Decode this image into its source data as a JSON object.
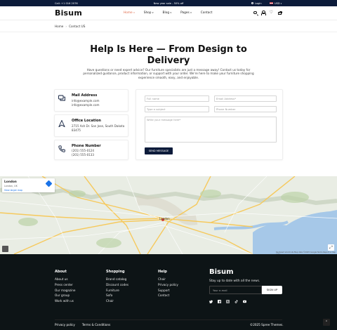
{
  "topbar": {
    "contact": "Call: +1 016 2076",
    "promo": "New year sale - 50% off",
    "login": "Login",
    "currency": "USD"
  },
  "header": {
    "logo": "Bisum",
    "nav": [
      {
        "label": "Home",
        "active": true
      },
      {
        "label": "Shop",
        "active": false
      },
      {
        "label": "Blog",
        "active": false
      },
      {
        "label": "Pages",
        "active": false
      },
      {
        "label": "Contact",
        "active": false
      }
    ],
    "icons": [
      "search-icon",
      "user-icon",
      "heart-icon",
      "bag-icon"
    ]
  },
  "breadcrumb": {
    "home": "Home",
    "current": "Contact US"
  },
  "hero": {
    "title_line1": "Help Is Here — From Design to",
    "title_line2": "Delivery",
    "text": "Have questions or need expert advice? Our furniture specialists are just a message away! Contact us today for personalized guidance, product information, or support with your order. We're here to make your furniture shopping experience smooth, easy, and enjoyable."
  },
  "cards": {
    "address": {
      "title": "Mail Address",
      "line1": "info@example.com",
      "line2": "info@example.com",
      "icon": "chat-icon"
    },
    "office": {
      "title": "Office Location",
      "line1": "2715 Ash Dr. San Jose, South Dakota",
      "line2": "83475",
      "icon": "location-arrow-icon"
    },
    "phone": {
      "title": "Phone Number",
      "line1": "(201) 555-0124",
      "line2": "(201) 555-0133",
      "icon": "phone-icon"
    }
  },
  "form": {
    "full_name": "Full name",
    "email": "Email Address*",
    "subject": "Type a subject",
    "phone": "Phone Number",
    "message": "Write your message here*",
    "submit": "SEND MESSAGE"
  },
  "map": {
    "place": "London",
    "place_sub": "London, UK",
    "link": "View larger map",
    "city_label": "London",
    "attribution": "Keyboard shortcuts   Map data ©2025 Google   Terms   Report a map error"
  },
  "footer": {
    "about": {
      "heading": "About",
      "items": [
        "About us",
        "Press center",
        "Our magazine",
        "Our group",
        "Work with us"
      ]
    },
    "shopping": {
      "heading": "Shopping",
      "items": [
        "Brand catalog",
        "Discount codes",
        "Furniture",
        "Sofa",
        "Chair"
      ]
    },
    "help": {
      "heading": "Help",
      "items": [
        "Chair",
        "Privacy policy",
        "Support",
        "Contact"
      ]
    },
    "logo": "Bisum",
    "newsletter": "Stay up to date with all the news.",
    "email_placeholder": "Your e-mail",
    "signup": "SIGN UP",
    "social": [
      "twitter-icon",
      "facebook-icon",
      "instagram-icon",
      "tiktok-icon",
      "youtube-icon"
    ],
    "bottom_links": [
      "Privacy policy",
      "Terms & Conditions"
    ],
    "copyright": "©2025 Spree Themes."
  }
}
